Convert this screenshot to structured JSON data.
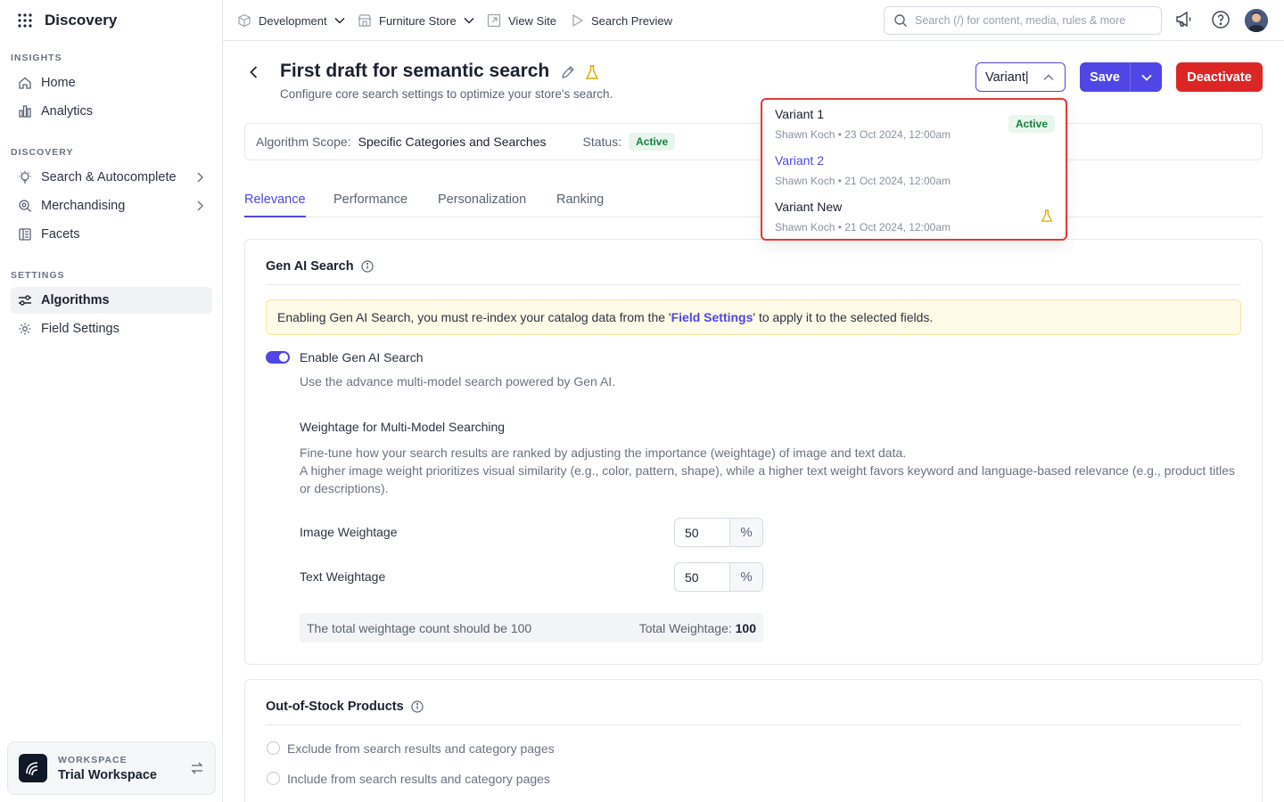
{
  "app": {
    "title": "Discovery"
  },
  "sidebar": {
    "sections": {
      "insights": "INSIGHTS",
      "discovery": "DISCOVERY",
      "settings": "SETTINGS"
    },
    "items": [
      {
        "label": "Home",
        "icon": "home-icon"
      },
      {
        "label": "Analytics",
        "icon": "analytics-icon"
      },
      {
        "label": "Search & Autocomplete",
        "icon": "bulb-icon"
      },
      {
        "label": "Merchandising",
        "icon": "merch-icon"
      },
      {
        "label": "Facets",
        "icon": "facets-icon"
      },
      {
        "label": "Algorithms",
        "icon": "sliders-icon",
        "active": true
      },
      {
        "label": "Field Settings",
        "icon": "gear-icon"
      }
    ],
    "workspace": {
      "label": "WORKSPACE",
      "name": "Trial Workspace"
    }
  },
  "topbar": {
    "environment": "Development",
    "store": "Furniture Store",
    "view_site": "View Site",
    "search_preview": "Search Preview",
    "search_placeholder": "Search (/) for content, media, rules & more"
  },
  "header": {
    "title": "First draft for semantic search",
    "subtitle": "Configure core search settings to optimize your store's search.",
    "variant_value": "Variant|",
    "save_label": "Save",
    "deactivate_label": "Deactivate"
  },
  "scope": {
    "label": "Algorithm Scope:",
    "value": "Specific Categories and Searches",
    "status_label": "Status:",
    "status_value": "Active"
  },
  "tabs": [
    "Relevance",
    "Performance",
    "Personalization",
    "Ranking"
  ],
  "gen_ai": {
    "title": "Gen AI Search",
    "notice_pre": "Enabling Gen AI Search, you must re-index your catalog data from the '",
    "notice_link": "Field Settings",
    "notice_post": "' to apply it to the selected fields.",
    "toggle_label": "Enable Gen AI Search",
    "toggle_desc": "Use the advance multi-model search powered by Gen AI.",
    "enabled": true,
    "weight_title": "Weightage for Multi-Model Searching",
    "weight_desc_1": "Fine-tune how your search results are ranked by adjusting the importance (weightage) of image and text data.",
    "weight_desc_2": "A higher image weight prioritizes visual similarity (e.g., color, pattern, shape), while a higher text weight favors keyword and language-based relevance (e.g., product titles or descriptions).",
    "image_label": "Image Weightage",
    "image_value": "50",
    "text_label": "Text Weightage",
    "text_value": "50",
    "unit": "%",
    "total_hint": "The total weightage count should be 100",
    "total_label": "Total Weightage:",
    "total_value": "100"
  },
  "out_of_stock": {
    "title": "Out-of-Stock Products",
    "options": [
      "Exclude from search results and category pages",
      "Include from search results and category pages"
    ]
  },
  "variants": [
    {
      "name": "Variant 1",
      "meta": "Shawn Koch • 23 Oct 2024, 12:00am",
      "badge": "Active"
    },
    {
      "name": "Variant 2",
      "meta": "Shawn Koch • 21 Oct 2024, 12:00am",
      "selected": true
    },
    {
      "name": "Variant New",
      "meta": "Shawn Koch • 21 Oct 2024, 12:00am",
      "badge_icon": "flask-icon"
    }
  ],
  "colors": {
    "accent": "#4f46e5",
    "danger": "#dc2626",
    "success": "#15803d",
    "warning": "#e0a800"
  }
}
